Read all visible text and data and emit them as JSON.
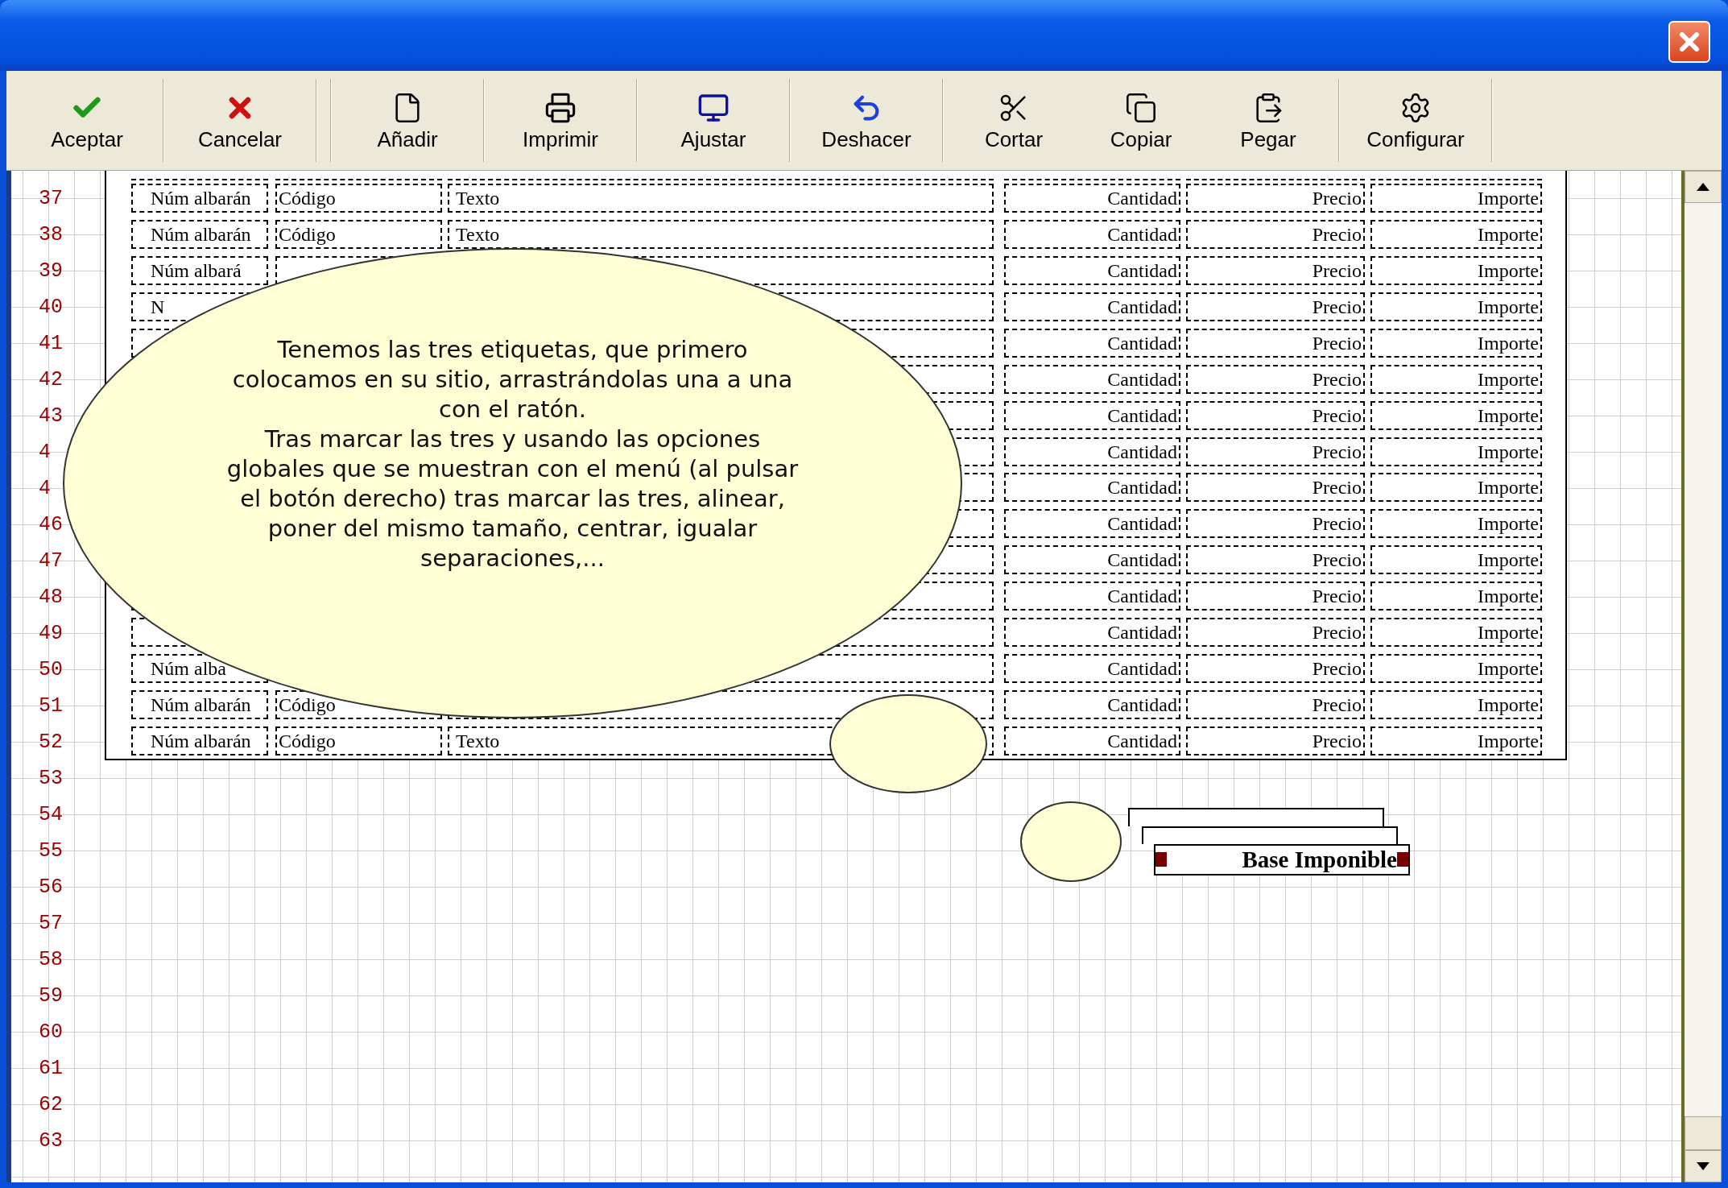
{
  "toolbar": [
    {
      "kind": "button",
      "label": "Aceptar"
    },
    {
      "kind": "separator"
    },
    {
      "kind": "button",
      "label": "Cancelar"
    },
    {
      "kind": "separator"
    },
    {
      "kind": "separator"
    },
    {
      "kind": "button",
      "label": "Añadir"
    },
    {
      "kind": "separator"
    },
    {
      "kind": "button",
      "label": "Imprimir"
    },
    {
      "kind": "separator"
    },
    {
      "kind": "button",
      "label": "Ajustar"
    },
    {
      "kind": "separator"
    },
    {
      "kind": "button",
      "label": "Deshacer"
    },
    {
      "kind": "separator"
    },
    {
      "kind": "button",
      "label": "Cortar"
    },
    {
      "kind": "button",
      "label": "Copiar"
    },
    {
      "kind": "button",
      "label": "Pegar"
    },
    {
      "kind": "separator"
    },
    {
      "kind": "button",
      "label": "Configurar"
    },
    {
      "kind": "separator"
    }
  ],
  "ruler_rows": [
    "37",
    "38",
    "39",
    "40",
    "41",
    "42",
    "43",
    "4",
    "4",
    "46",
    "47",
    "48",
    "49",
    "50",
    "51",
    "52",
    "53",
    "54",
    "55",
    "56",
    "57",
    "58",
    "59",
    "60",
    "61",
    "62",
    "63"
  ],
  "report_rows": [
    {
      "num_albaran": "Núm albarán",
      "codigo": "Código",
      "texto": "Texto",
      "cantidad": "Cantidad",
      "precio": "Precio",
      "importe": "Importe"
    },
    {
      "num_albaran": "Núm albarán",
      "codigo": "Código",
      "texto": "Texto",
      "cantidad": "Cantidad",
      "precio": "Precio",
      "importe": "Importe"
    },
    {
      "num_albaran": "Núm albará",
      "cantidad": "Cantidad",
      "precio": "Precio",
      "importe": "Importe"
    },
    {
      "num_albaran": "N",
      "cantidad": "Cantidad",
      "precio": "Precio",
      "importe": "Importe"
    },
    {
      "cantidad": "Cantidad",
      "precio": "Precio",
      "importe": "Importe"
    },
    {
      "cantidad": "Cantidad",
      "precio": "Precio",
      "importe": "Importe"
    },
    {
      "cantidad": "Cantidad",
      "precio": "Precio",
      "importe": "Importe"
    },
    {
      "cantidad": "Cantidad",
      "precio": "Precio",
      "importe": "Importe"
    },
    {
      "cantidad": "Cantidad",
      "precio": "Precio",
      "importe": "Importe"
    },
    {
      "cantidad": "Cantidad",
      "precio": "Precio",
      "importe": "Importe"
    },
    {
      "cantidad": "Cantidad",
      "precio": "Precio",
      "importe": "Importe"
    },
    {
      "cantidad": "Cantidad",
      "precio": "Precio",
      "importe": "Importe"
    },
    {
      "cantidad": "Cantidad",
      "precio": "Precio",
      "importe": "Importe"
    },
    {
      "num_albaran": "Núm alba",
      "cantidad": "Cantidad",
      "precio": "Precio",
      "importe": "Importe"
    },
    {
      "num_albaran": "Núm albarán",
      "codigo": "Código",
      "cantidad": "Cantidad",
      "precio": "Precio",
      "importe": "Importe"
    },
    {
      "num_albaran": "Núm albarán",
      "codigo": "Código",
      "texto": "Texto",
      "cantidad": "Cantidad",
      "precio": "Precio",
      "importe": "Importe"
    }
  ],
  "note": [
    "Tenemos las tres etiquetas, que primero colocamos en su sitio, arrastrándolas una a una con el ratón.",
    "Tras marcar las tres y usando las opciones globales  que se muestran con el menú (al pulsar el  botón derecho) tras marcar las tres, alinear, poner del mismo tamaño, centrar, igualar separaciones,..."
  ],
  "labels": [
    {
      "selected": false
    },
    {
      "selected": false
    },
    {
      "text": "Base Imponible",
      "selected": true
    }
  ]
}
